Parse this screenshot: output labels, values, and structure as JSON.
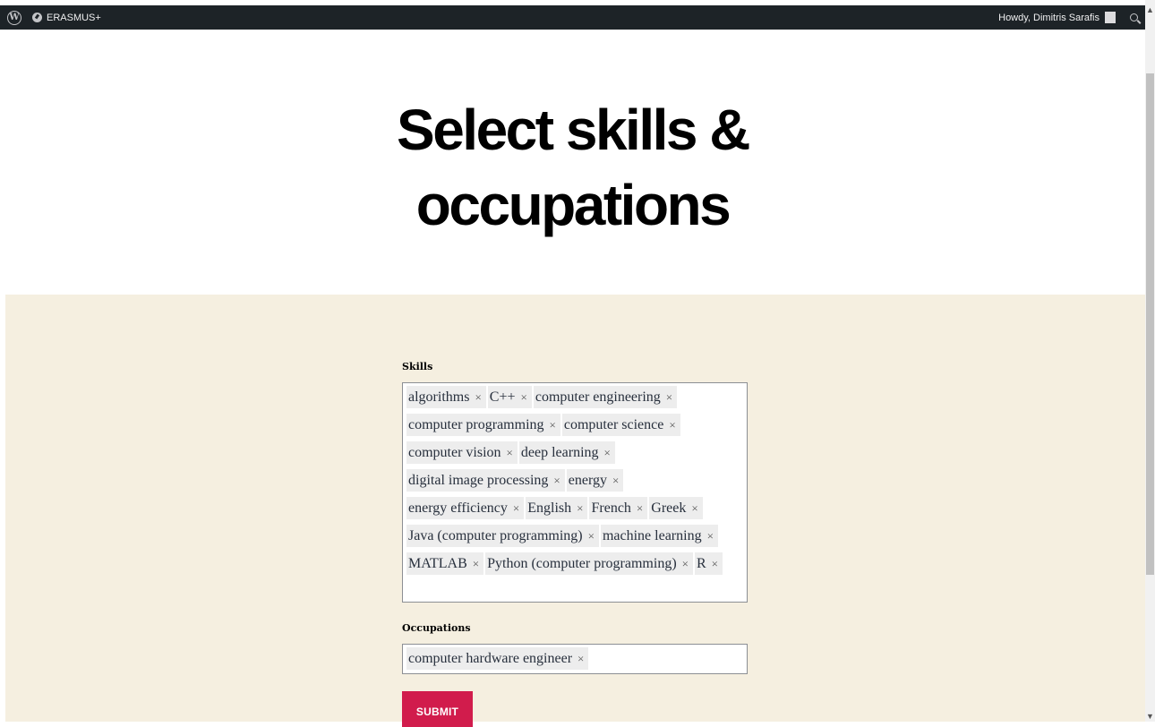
{
  "admin_bar": {
    "site_name": "ERASMUS+",
    "greeting": "Howdy, Dimitris Sarafis"
  },
  "page": {
    "title_line1": "Select skills &",
    "title_line2": "occupations"
  },
  "form": {
    "skills_label": "Skills",
    "skills_rows": [
      [
        "algorithms",
        "C++",
        "computer engineering"
      ],
      [
        "computer programming",
        "computer science"
      ],
      [
        "computer vision",
        "deep learning"
      ],
      [
        "digital image processing",
        "energy"
      ],
      [
        "energy efficiency",
        "English",
        "French",
        "Greek"
      ],
      [
        "Java (computer programming)",
        "machine learning"
      ],
      [
        "MATLAB",
        "Python (computer programming)",
        "R"
      ]
    ],
    "occupations_label": "Occupations",
    "occupations": [
      "computer hardware engineer"
    ],
    "remove_glyph": "×",
    "submit_label": "SUBMIT"
  },
  "colors": {
    "admin_bar_bg": "#1d2327",
    "section_bg": "#f5efe0",
    "button_bg": "#d11c4c",
    "tag_bg": "#ededed"
  }
}
